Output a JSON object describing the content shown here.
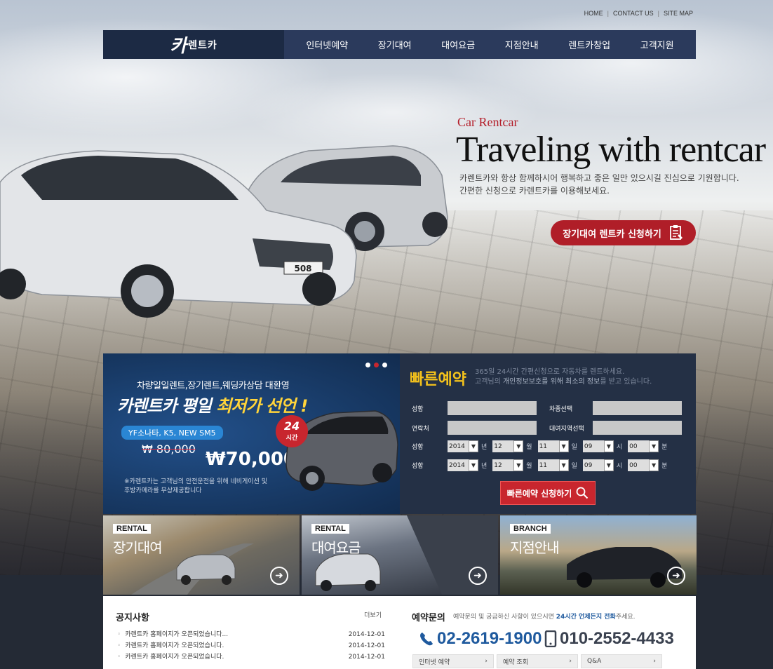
{
  "toplinks": {
    "home": "HOME",
    "contact": "CONTACT US",
    "sitemap": "SITE MAP",
    "sep": "|"
  },
  "nav": {
    "logo_mark": "카",
    "logo_text": "렌트카",
    "items": [
      "인터넷예약",
      "장기대여",
      "대여요금",
      "지점안내",
      "렌트카창업",
      "고객지원"
    ]
  },
  "hero": {
    "subtitle": "Car Rentcar",
    "title": "Traveling with rentcar",
    "desc1": "카렌트카와 항상 함께하시어 행복하고 좋은 일만 있으시길 진심으로 기원합니다.",
    "desc2": "간편한 신청으로 카렌트카를 이용해보세요.",
    "button": "장기대여 렌트카 신청하기",
    "car_plate": "508"
  },
  "promo": {
    "top": "차량일일렌트,장기렌트,웨딩카상담 대환영",
    "headline_a": "카렌트카 평일 ",
    "headline_b": "최저가 선언 !",
    "models": "YF소나타, K5, NEW SM5",
    "old_price": "₩ 80,000",
    "new_price": "₩70,000",
    "badge_num": "24",
    "badge_label": "시간",
    "note1": "※카렌트카는 고객님의 안전운전을 위해 네비게이션 및",
    "note2": "후방카메라를 무상제공합니다"
  },
  "quick": {
    "title": "빠른예약",
    "desc1": "365일 24시간 간편신청으로 자동차를 렌트하세요.",
    "desc2a": "고객님의 ",
    "desc2b": "개인정보보호를 위해 최소의 정보",
    "desc2c": "를 받고 있습니다.",
    "name_label": "성함",
    "car_label": "차종선택",
    "contact_label": "연락처",
    "region_label": "대여지역선택",
    "date1_label": "성함",
    "date2_label": "성함",
    "year": "2014",
    "month": "12",
    "day": "11",
    "hour": "09",
    "minute": "00",
    "unit_year": "년",
    "unit_month": "월",
    "unit_day": "일",
    "unit_hour": "시",
    "unit_minute": "분",
    "button": "빠른예약 신청하기"
  },
  "panels": [
    {
      "tag": "RENTAL",
      "title": "장기대여"
    },
    {
      "tag": "RENTAL",
      "title": "대여요금"
    },
    {
      "tag": "BRANCH",
      "title": "지점안내"
    }
  ],
  "notice": {
    "title": "공지사항",
    "more": "더보기",
    "items": [
      {
        "text": "카렌트카 홈페이지가 오픈되었습니다...",
        "date": "2014-12-01"
      },
      {
        "text": "카렌트카 홈페이지가 오픈되었습니다.",
        "date": "2014-12-01"
      },
      {
        "text": "카렌트카 홈페이지가 오픈되었습니다.",
        "date": "2014-12-01"
      }
    ]
  },
  "inquiry": {
    "title": "예약문의",
    "desc_a": "예약문의 및 궁금하신 사항이 있으시면 ",
    "desc_b": "24시간 언제든지 전화",
    "desc_c": "주세요.",
    "phone1": "02-2619-1900",
    "phone2": "010-2552-4433",
    "links": [
      "인터넷 예약",
      "예약 조회",
      "Q&A"
    ]
  },
  "colors": {
    "nav_bg": "#2b3a5c",
    "accent_red": "#b01e28",
    "quick_title": "#f4c21c",
    "phone_blue": "#1f5a9e"
  }
}
